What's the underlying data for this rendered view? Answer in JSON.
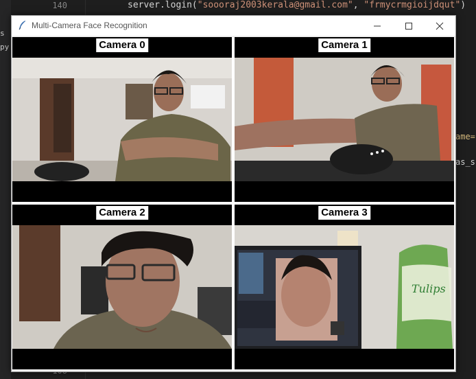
{
  "editor": {
    "line_top": "140",
    "line_bottom": "108",
    "code": {
      "prefix": "server.login(",
      "arg1": "\"soooraj2003kerala@gmail.com\"",
      "sep": ", ",
      "arg2": "\"frmycrmgioijdqut\"",
      "suffix": ")"
    },
    "left_gutter": [
      "s",
      "py"
    ],
    "side_fragments": [
      "ame=",
      "as_s"
    ]
  },
  "window": {
    "title": "Multi-Camera Face Recognition",
    "controls": [
      "minimize-icon",
      "maximize-icon",
      "close-icon"
    ]
  },
  "cameras": [
    {
      "label": "Camera 0"
    },
    {
      "label": "Camera 1"
    },
    {
      "label": "Camera 2"
    },
    {
      "label": "Camera 3"
    }
  ]
}
